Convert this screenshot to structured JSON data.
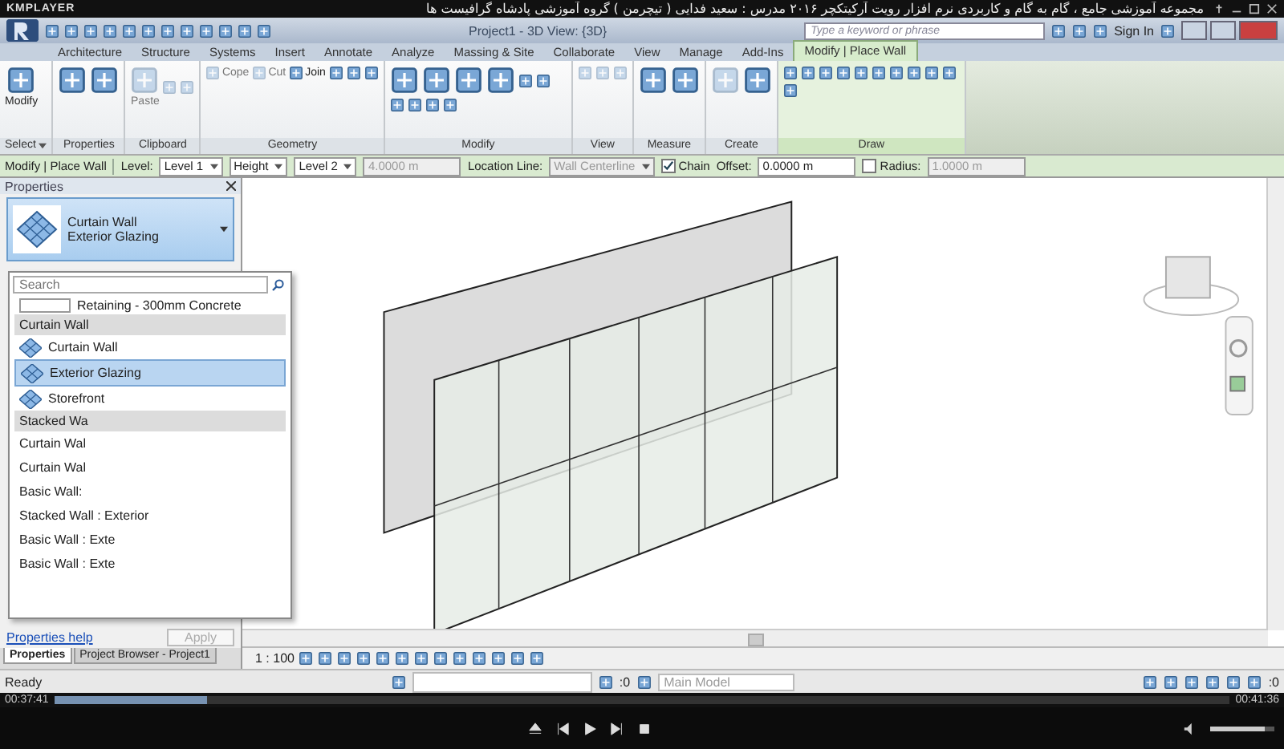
{
  "player": {
    "brand": "KMPLAYER",
    "title": "مجموعه آموزشی جامع ، گام به گام و کاربردی نرم افزار رویت آرکیتکچر ۲۰۱۶   مدرس : سعید فدایی ( تیچرمن ) گروه آموزشی پادشاه گرافیست ها",
    "elapsed": "00:37:41",
    "total": "00:41:36",
    "progress": {
      "level": 0.13
    },
    "volume": {
      "level": 0.85
    }
  },
  "window": {
    "title": "Project1 - 3D View: {3D}",
    "search": {
      "placeholder": "Type a keyword or phrase"
    },
    "sign_in": "Sign In"
  },
  "tabs": [
    {
      "label": "Architecture",
      "selected": false
    },
    {
      "label": "Structure",
      "selected": false
    },
    {
      "label": "Systems",
      "selected": false
    },
    {
      "label": "Insert",
      "selected": false
    },
    {
      "label": "Annotate",
      "selected": false
    },
    {
      "label": "Analyze",
      "selected": false
    },
    {
      "label": "Massing & Site",
      "selected": false
    },
    {
      "label": "Collaborate",
      "selected": false
    },
    {
      "label": "View",
      "selected": false
    },
    {
      "label": "Manage",
      "selected": false
    },
    {
      "label": "Add-Ins",
      "selected": false
    },
    {
      "label": "Modify | Place Wall",
      "selected": true
    }
  ],
  "ribbon": [
    {
      "label": "Select",
      "menu": true,
      "tools": [
        {
          "kind": "large",
          "label": "Modify",
          "disabled": false
        }
      ]
    },
    {
      "label": "Properties",
      "menu": false,
      "tools": [
        {
          "kind": "large",
          "disabled": false
        },
        {
          "kind": "large",
          "disabled": false
        }
      ]
    },
    {
      "label": "Clipboard",
      "menu": false,
      "tools": [
        {
          "kind": "large",
          "label": "Paste",
          "disabled": true
        },
        {
          "kind": "small",
          "disabled": true
        },
        {
          "kind": "small",
          "disabled": true
        }
      ]
    },
    {
      "label": "Geometry",
      "menu": false,
      "tools": [
        {
          "kind": "small",
          "label": "Cope",
          "disabled": true
        },
        {
          "kind": "small",
          "label": "Cut",
          "disabled": true
        },
        {
          "kind": "small",
          "label": "Join",
          "disabled": false
        },
        {
          "kind": "small",
          "disabled": false
        },
        {
          "kind": "small",
          "disabled": false
        },
        {
          "kind": "small",
          "disabled": false
        }
      ]
    },
    {
      "label": "Modify",
      "menu": false,
      "tools": [
        {
          "kind": "large",
          "disabled": false
        },
        {
          "kind": "large",
          "disabled": false
        },
        {
          "kind": "large",
          "disabled": false
        },
        {
          "kind": "large",
          "disabled": false
        },
        {
          "kind": "small",
          "disabled": false
        },
        {
          "kind": "small",
          "disabled": false
        },
        {
          "kind": "small",
          "disabled": false
        },
        {
          "kind": "small",
          "disabled": false
        },
        {
          "kind": "small",
          "disabled": false
        },
        {
          "kind": "small",
          "disabled": false
        }
      ]
    },
    {
      "label": "View",
      "menu": false,
      "tools": [
        {
          "kind": "small",
          "disabled": true
        },
        {
          "kind": "small",
          "disabled": true
        },
        {
          "kind": "small",
          "disabled": true
        }
      ]
    },
    {
      "label": "Measure",
      "menu": false,
      "tools": [
        {
          "kind": "large",
          "disabled": false
        },
        {
          "kind": "large",
          "disabled": false
        }
      ]
    },
    {
      "label": "Create",
      "menu": false,
      "tools": [
        {
          "kind": "large",
          "disabled": true
        },
        {
          "kind": "large",
          "disabled": false
        }
      ]
    },
    {
      "label": "Draw",
      "menu": false,
      "tools": [
        {
          "kind": "small",
          "disabled": false
        },
        {
          "kind": "small",
          "disabled": false
        },
        {
          "kind": "small",
          "disabled": false
        },
        {
          "kind": "small",
          "disabled": false
        },
        {
          "kind": "small",
          "disabled": false
        },
        {
          "kind": "small",
          "disabled": false
        },
        {
          "kind": "small",
          "disabled": false
        },
        {
          "kind": "small",
          "disabled": false
        },
        {
          "kind": "small",
          "disabled": false
        },
        {
          "kind": "small",
          "disabled": false
        },
        {
          "kind": "small",
          "disabled": false
        }
      ]
    }
  ],
  "options_bar": [
    {
      "kind": "title",
      "text": "Modify | Place Wall"
    },
    {
      "kind": "label",
      "text": "Level:"
    },
    {
      "kind": "select",
      "text": "Level 1",
      "disabled": false
    },
    {
      "kind": "select",
      "text": "Height",
      "disabled": false
    },
    {
      "kind": "select",
      "text": "Level 2",
      "disabled": false
    },
    {
      "kind": "field",
      "text": "4.0000 m",
      "disabled": true
    },
    {
      "kind": "label",
      "text": "Location Line:"
    },
    {
      "kind": "select",
      "text": "Wall Centerline",
      "disabled": true
    },
    {
      "kind": "check",
      "text": "Chain",
      "checked": true
    },
    {
      "kind": "label",
      "text": "Offset:"
    },
    {
      "kind": "field",
      "text": "0.0000 m",
      "disabled": false
    },
    {
      "kind": "check",
      "text": "Radius:",
      "checked": false
    },
    {
      "kind": "field",
      "text": "1.0000 m",
      "disabled": true
    }
  ],
  "properties": {
    "title": "Properties",
    "type_family": "Curtain Wall",
    "type_name": "Exterior Glazing",
    "help": "Properties help",
    "apply": "Apply",
    "tabs": [
      {
        "label": "Properties",
        "selected": true
      },
      {
        "label": "Project Browser - Project1",
        "selected": false
      }
    ]
  },
  "type_dropdown": {
    "search": {
      "placeholder": "Search"
    },
    "items": [
      {
        "kind": "swatch",
        "text": "Retaining - 300mm Concrete",
        "selected": false
      },
      {
        "kind": "header",
        "text": "Curtain Wall",
        "selected": false
      },
      {
        "kind": "curtain",
        "text": "Curtain Wall",
        "selected": false
      },
      {
        "kind": "curtain",
        "text": "Exterior Glazing",
        "selected": true
      },
      {
        "kind": "curtain",
        "text": "Storefront",
        "selected": false
      },
      {
        "kind": "header",
        "text": "Stacked Wa",
        "selected": false
      },
      {
        "kind": "plain",
        "text": "Curtain Wal",
        "selected": false
      },
      {
        "kind": "plain",
        "text": "Curtain Wal",
        "selected": false
      },
      {
        "kind": "plain",
        "text": "Basic Wall:",
        "selected": false
      },
      {
        "kind": "plain",
        "text": "Stacked Wall : Exterior",
        "selected": false
      },
      {
        "kind": "plain",
        "text": "Basic Wall : Exte",
        "selected": false
      },
      {
        "kind": "plain",
        "text": "Basic Wall : Exte",
        "selected": false
      }
    ]
  },
  "view_control": {
    "scale": "1 : 100"
  },
  "status_bar": {
    "text": "Ready",
    "selection_count": ":0",
    "workset": "Main Model",
    "filter_count": ":0"
  }
}
